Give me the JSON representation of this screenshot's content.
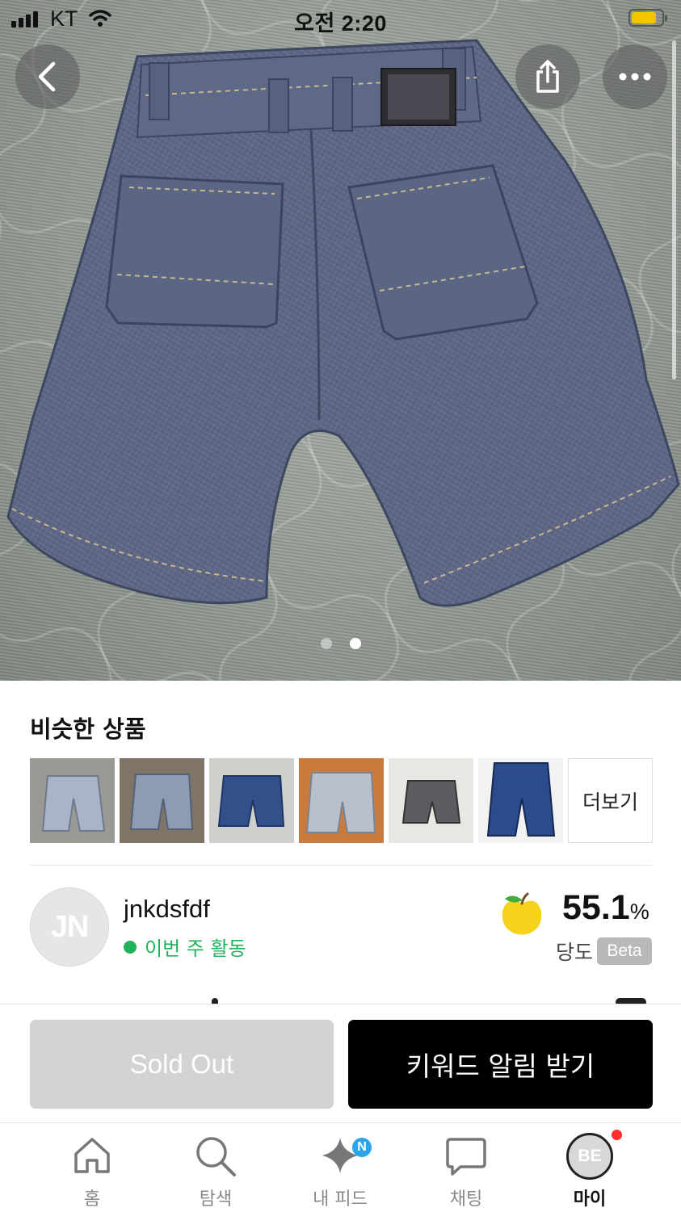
{
  "status_bar": {
    "carrier": "KT",
    "time": "오전 2:20"
  },
  "hero": {
    "icons": {
      "back": "chevron-left-icon",
      "share": "share-icon",
      "more": "more-horizontal-icon"
    },
    "photo_count": 2,
    "active_photo": 2
  },
  "similar": {
    "title": "비슷한 상품",
    "more_label": "더보기",
    "thumb_count": 6
  },
  "seller": {
    "initials": "JN",
    "name": "jnkdsfdf",
    "activity": "이번 주 활동",
    "sweetness_value": "55.1",
    "sweetness_unit": "%",
    "sweetness_label": "당도",
    "beta_label": "Beta"
  },
  "actions": {
    "sold_out_label": "Sold Out",
    "keyword_label": "키워드 알림 받기"
  },
  "tabs": [
    {
      "label": "홈",
      "icon": "home-icon"
    },
    {
      "label": "탐색",
      "icon": "search-icon"
    },
    {
      "label": "내 피드",
      "icon": "sparkle-icon",
      "badge": "N"
    },
    {
      "label": "채팅",
      "icon": "chat-icon"
    },
    {
      "label": "마이",
      "icon": "avatar",
      "avatar_text": "BE"
    }
  ],
  "colors": {
    "active_green": "#1fb25a",
    "sold_out_gray": "#d3d3d3",
    "primary_black": "#000000",
    "notification_red": "#ff2d2d",
    "new_badge_blue": "#2aa6e8"
  }
}
